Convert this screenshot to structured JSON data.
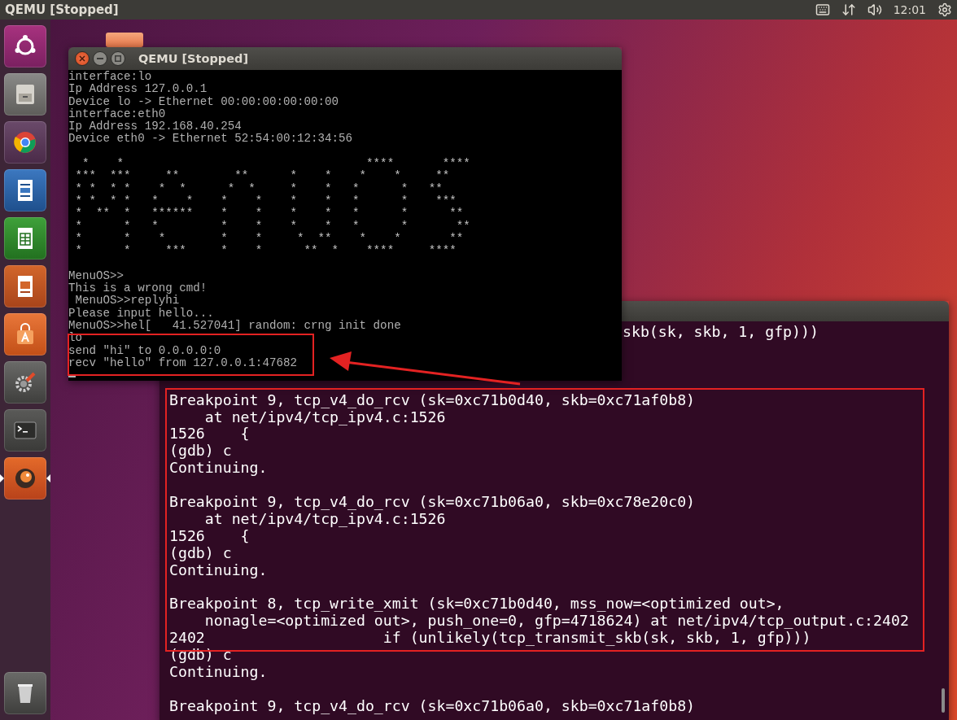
{
  "top_bar": {
    "title": "QEMU [Stopped]",
    "clock": "12:01"
  },
  "qemu_window": {
    "title": "QEMU [Stopped]",
    "blocks": [
      {
        "kind": "text",
        "lines": [
          "interface:lo",
          "Ip Address 127.0.0.1",
          "Device lo -> Ethernet 00:00:00:00:00:00",
          "interface:eth0",
          "Ip Address 192.168.40.254",
          "Device eth0 -> Ethernet 52:54:00:12:34:56"
        ]
      },
      {
        "kind": "art",
        "lines": [
          "  *    *                                   ****       ****\n ***  ***     **        **      *    *    *    *     **\n * *  * *    *  *      *  *     *    *   *      *   **\n * *  * *   *    *    *    *    *    *   *      *    ***\n *  **  *   ******    *    *    *    *   *      *      **\n *      *   *         *    *    *    *   *      *       **\n *      *    *        *    *     *  **    *    *       **\n *      *     ***     *    *      **  *    ****     ****"
        ]
      },
      {
        "kind": "text",
        "lines": [
          "MenuOS>>",
          "This is a wrong cmd!",
          " MenuOS>>replyhi",
          "Please input hello...",
          "MenuOS>>hel[   41.527041] random: crng init done",
          "lo",
          "send \"hi\" to 0.0.0.0:0",
          "recv \"hello\" from 127.0.0.1:47682"
        ]
      }
    ]
  },
  "terminal": {
    "partial_line": "skb(sk, skb, 1, gfp)))",
    "blocks": [
      [
        "Breakpoint 9, tcp_v4_do_rcv (sk=0xc71b0d40, skb=0xc71af0b8)",
        "    at net/ipv4/tcp_ipv4.c:1526",
        "1526    {",
        "(gdb) c",
        "Continuing."
      ],
      [
        "Breakpoint 9, tcp_v4_do_rcv (sk=0xc71b06a0, skb=0xc78e20c0)",
        "    at net/ipv4/tcp_ipv4.c:1526",
        "1526    {",
        "(gdb) c",
        "Continuing."
      ],
      [
        "Breakpoint 8, tcp_write_xmit (sk=0xc71b0d40, mss_now=<optimized out>,",
        "    nonagle=<optimized out>, push_one=0, gfp=4718624) at net/ipv4/tcp_output.c:2402",
        "2402                    if (unlikely(tcp_transmit_skb(sk, skb, 1, gfp)))",
        "(gdb) c",
        "Continuing."
      ],
      [
        "Breakpoint 9, tcp_v4_do_rcv (sk=0xc71b06a0, skb=0xc71af0b8)"
      ]
    ]
  }
}
